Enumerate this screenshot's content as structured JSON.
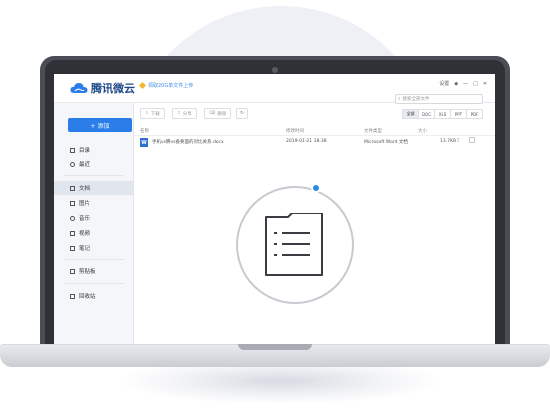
{
  "app": {
    "logo_text": "腾讯微云",
    "promo_text": "领取20G单文件上传",
    "window_controls": [
      "设置",
      "◆",
      "—",
      "□",
      "✕"
    ],
    "search_placeholder": "搜索全部文件"
  },
  "sidebar": {
    "add_label": "+ 添加",
    "items": [
      {
        "label": "目录",
        "icon": "folder-icon"
      },
      {
        "label": "最近",
        "icon": "clock-icon"
      },
      {
        "label": "文档",
        "icon": "document-icon",
        "active": true
      },
      {
        "label": "图片",
        "icon": "image-icon"
      },
      {
        "label": "音乐",
        "icon": "music-icon"
      },
      {
        "label": "视频",
        "icon": "video-icon"
      },
      {
        "label": "笔记",
        "icon": "note-icon"
      },
      {
        "label": "剪贴板",
        "icon": "clipboard-icon"
      },
      {
        "label": "回收站",
        "icon": "trash-icon"
      }
    ]
  },
  "toolbar": {
    "download": "下载",
    "share": "分享",
    "delete": "删除",
    "refresh_icon": "refresh-icon",
    "filters": [
      "全部",
      "DOC",
      "XLS",
      "PPT",
      "PDF"
    ],
    "active_filter": "全部"
  },
  "table": {
    "headers": [
      "名称",
      "修改时间",
      "文件类型",
      "大小"
    ],
    "rows": [
      {
        "icon": "W",
        "name": "手机vs腾vs备要面的对比关系.docx",
        "modified": "2019-01-21 18:38",
        "type": "Microsoft Word 文档",
        "size": "13.7KB"
      }
    ]
  },
  "colors": {
    "accent": "#2b7de9",
    "laptop_frame": "#2f3137",
    "overlay_dot": "#2b8ae8"
  }
}
